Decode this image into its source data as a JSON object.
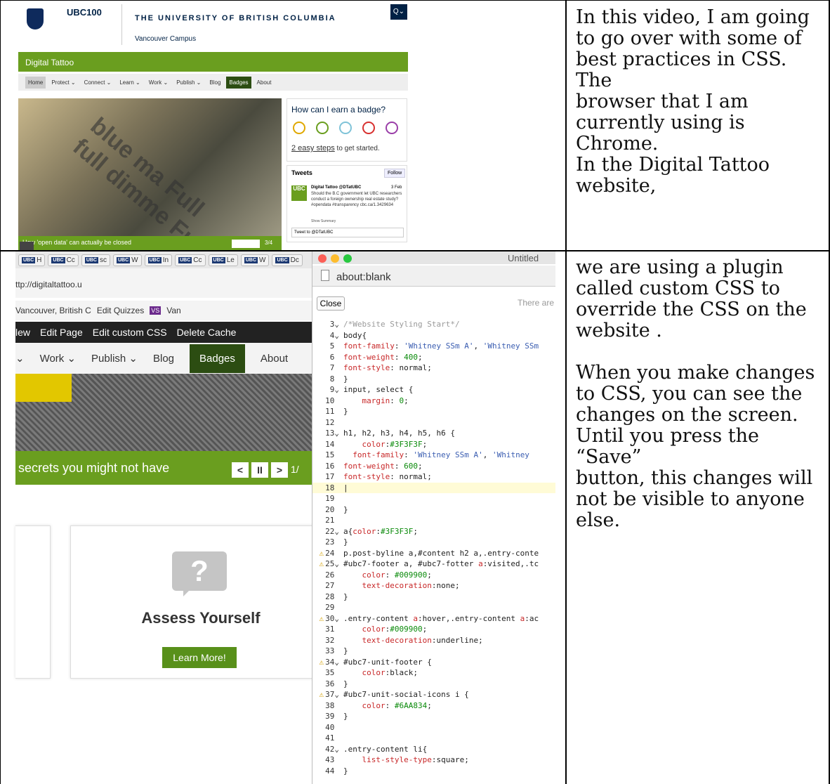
{
  "caption1": "In this video, I am going\nto go over with some of\nbest practices in CSS. The\nbrowser that I am\ncurrently using is\nChrome.\nIn the Digital Tattoo\nwebsite,",
  "caption2": "we are using a plugin\ncalled custom CSS to\noverride the CSS on the\nwebsite .\n\nWhen you make changes\nto CSS, you can see the\nchanges on the screen.\nUntil you press the “Save”\nbutton, this changes will\nnot be visible to anyone\nelse.",
  "shot1": {
    "ubc100": "UBC100",
    "university": "THE UNIVERSITY OF BRITISH COLUMBIA",
    "campus": "Vancouver Campus",
    "site": "Digital Tattoo",
    "search_label": "Q⌄",
    "nav": [
      "Home",
      "Protect ⌄",
      "Connect ⌄",
      "Learn ⌄",
      "Work ⌄",
      "Publish ⌄",
      "Blog",
      "Badges",
      "About"
    ],
    "hero_text": "blue ma Full full dimme Full",
    "hero_caption": "How 'open data' can actually be closed",
    "slide_num": "3/4",
    "badge_title": "How can I earn a badge?",
    "steps_link": "2 easy steps",
    "steps_rest": " to get started.",
    "tweets": "Tweets",
    "follow": "Follow",
    "tweet_logo": "UBC",
    "tweet_name": "Digital Tattoo @DTatUBC",
    "tweet_date": "3 Feb",
    "tweet_text": "Should the B.C government let UBC researchers conduct a foreign ownership real estate study? #opendata #transparency cbc.ca/1.3429634",
    "show_summary": "Show Summary",
    "tweet_to": "Tweet to @DTatUBC"
  },
  "shot2": {
    "tabs": [
      "H",
      "Cc",
      "sc",
      "W",
      "In",
      "Cc",
      "Le",
      "W",
      "Dc"
    ],
    "url": "ttp://digitaltattoo.u",
    "bookmarks": [
      "Vancouver, British C",
      "Edit Quizzes",
      "VS",
      "Van"
    ],
    "admin": [
      "lew",
      "Edit Page",
      "Edit custom CSS",
      "Delete Cache"
    ],
    "nav": [
      "⌄",
      "Work ⌄",
      "Publish ⌄",
      "Blog",
      "Badges",
      "About"
    ],
    "hero_caption": "secrets you might not have",
    "slide_num": "1/",
    "ctl": [
      "<",
      "II",
      ">"
    ],
    "card_icon": "?",
    "card_title": "Assess Yourself",
    "card_button": "Learn More!",
    "window_title": "Untitled",
    "address": "about:blank",
    "close": "Close",
    "there": "There are",
    "code": [
      {
        "n": "3",
        "t": "/*Website Styling Start*/",
        "k": "cm",
        "fold": true
      },
      {
        "n": "4",
        "t": "body{",
        "fold": true
      },
      {
        "n": "5",
        "t": "font-family: 'Whitney SSm A', 'Whitney SSm"
      },
      {
        "n": "6",
        "t": "font-weight: 400;"
      },
      {
        "n": "7",
        "t": "font-style: normal;"
      },
      {
        "n": "8",
        "t": "}"
      },
      {
        "n": "9",
        "t": "input, select {",
        "fold": true
      },
      {
        "n": "10",
        "t": "    margin: 0;"
      },
      {
        "n": "11",
        "t": "}"
      },
      {
        "n": "12",
        "t": ""
      },
      {
        "n": "13",
        "t": "h1, h2, h3, h4, h5, h6 {",
        "fold": true
      },
      {
        "n": "14",
        "t": "    color:#3F3F3F;"
      },
      {
        "n": "15",
        "t": "  font-family: 'Whitney SSm A', 'Whitney"
      },
      {
        "n": "16",
        "t": "font-weight: 600;"
      },
      {
        "n": "17",
        "t": "font-style: normal;"
      },
      {
        "n": "18",
        "t": "|",
        "hl": true
      },
      {
        "n": "19",
        "t": ""
      },
      {
        "n": "20",
        "t": "}"
      },
      {
        "n": "21",
        "t": ""
      },
      {
        "n": "22",
        "t": "a{color:#3F3F3F;",
        "fold": true
      },
      {
        "n": "23",
        "t": "}"
      },
      {
        "n": "24",
        "t": "p.post-byline a,#content h2 a,.entry-conte",
        "warn": true
      },
      {
        "n": "25",
        "t": "#ubc7-footer a, #ubc7-fotter a:visited,.tc",
        "warn": true,
        "fold": true
      },
      {
        "n": "26",
        "t": "    color: #009900;"
      },
      {
        "n": "27",
        "t": "    text-decoration:none;"
      },
      {
        "n": "28",
        "t": "}"
      },
      {
        "n": "29",
        "t": ""
      },
      {
        "n": "30",
        "t": ".entry-content a:hover,.entry-content a:ac",
        "warn": true,
        "fold": true
      },
      {
        "n": "31",
        "t": "    color:#009900;"
      },
      {
        "n": "32",
        "t": "    text-decoration:underline;"
      },
      {
        "n": "33",
        "t": "}"
      },
      {
        "n": "34",
        "t": "#ubc7-unit-footer {",
        "warn": true,
        "fold": true
      },
      {
        "n": "35",
        "t": "    color:black;"
      },
      {
        "n": "36",
        "t": "}"
      },
      {
        "n": "37",
        "t": "#ubc7-unit-social-icons i {",
        "warn": true,
        "fold": true
      },
      {
        "n": "38",
        "t": "    color: #6AA834;"
      },
      {
        "n": "39",
        "t": "}"
      },
      {
        "n": "40",
        "t": ""
      },
      {
        "n": "41",
        "t": ""
      },
      {
        "n": "42",
        "t": ".entry-content li{",
        "fold": true
      },
      {
        "n": "43",
        "t": "    list-style-type:square;"
      },
      {
        "n": "44",
        "t": "}"
      }
    ]
  },
  "colors": {
    "ubc_green": "#6a9e1f",
    "ubc_navy": "#002145",
    "dark_green": "#2c4d12"
  }
}
